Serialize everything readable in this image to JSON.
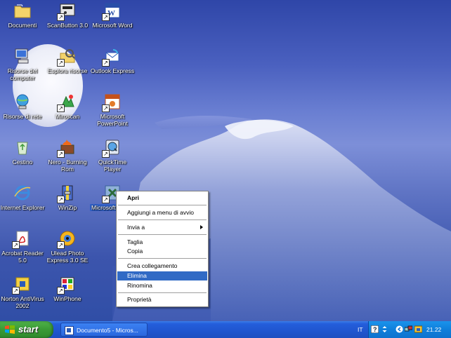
{
  "desktop": {
    "icons": [
      {
        "label": "Documenti"
      },
      {
        "label": "ScanButton 3.0"
      },
      {
        "label": "Microsoft Word"
      },
      {
        "label": "Risorse del computer"
      },
      {
        "label": "Esplora risorse"
      },
      {
        "label": "Outlook Express"
      },
      {
        "label": "Risorse di rete"
      },
      {
        "label": "Miroscan"
      },
      {
        "label": "Microsoft PowerPoint"
      },
      {
        "label": "Cestino"
      },
      {
        "label": "Nero - Burning Rom"
      },
      {
        "label": "QuickTime Player"
      },
      {
        "label": "Internet Explorer"
      },
      {
        "label": "WinZip"
      },
      {
        "label": "Microsoft"
      },
      {
        "label": "Acrobat Reader 5.0"
      },
      {
        "label": "Ulead Photo Express 3.0 SE"
      },
      {
        "label": "Norton AntiVirus 2002"
      },
      {
        "label": "WinPhone"
      }
    ]
  },
  "context_menu": {
    "items": [
      {
        "label": "Apri"
      },
      {
        "label": "Aggiungi a menu di avvio"
      },
      {
        "label": "Invia a"
      },
      {
        "label": "Taglia"
      },
      {
        "label": "Copia"
      },
      {
        "label": "Crea collegamento"
      },
      {
        "label": "Elimina"
      },
      {
        "label": "Rinomina"
      },
      {
        "label": "Proprietà"
      }
    ],
    "highlighted": "Elimina"
  },
  "taskbar": {
    "start_label": "start",
    "task_label": "Documento5 - Micros...",
    "language": "IT",
    "clock": "21.22"
  },
  "colors": {
    "taskbar_blue": "#245edb",
    "start_green": "#3a9a35",
    "menu_highlight": "#316ac5"
  }
}
